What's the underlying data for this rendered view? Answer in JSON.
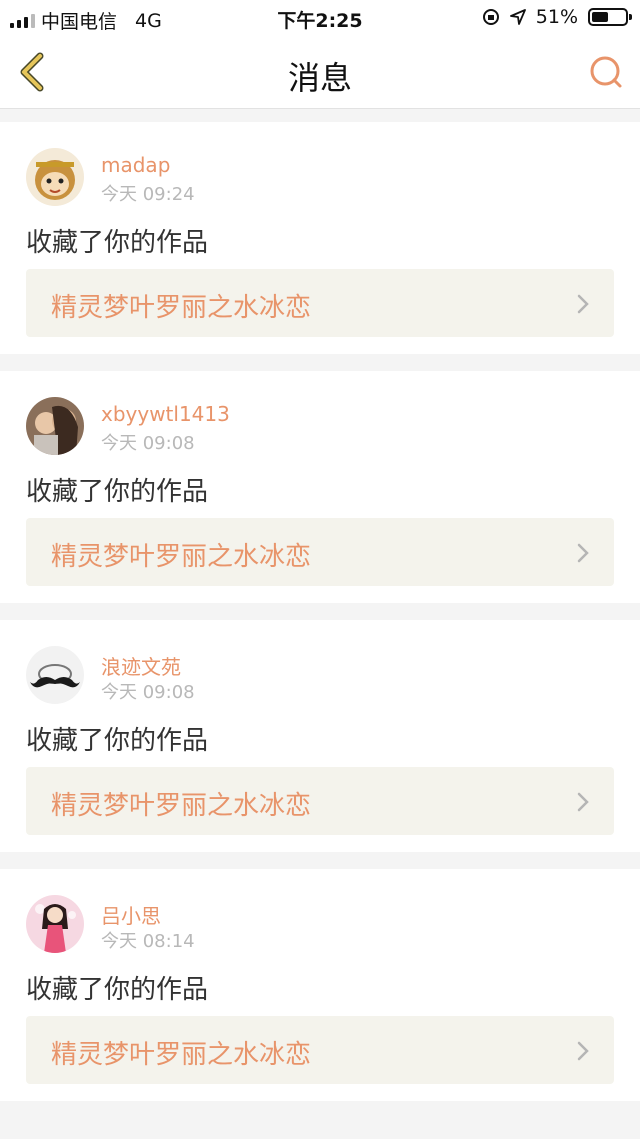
{
  "status_bar": {
    "carrier": "中国电信",
    "network": "4G",
    "time": "下午2:25",
    "battery": "51%",
    "battery_level": 0.51
  },
  "header": {
    "title": "消息"
  },
  "messages": [
    {
      "username": "madap",
      "time": "今天 09:24",
      "action": "收藏了你的作品",
      "work_title": "精灵梦叶罗丽之水冰恋"
    },
    {
      "username": "xbyywtl1413",
      "time": "今天 09:08",
      "action": "收藏了你的作品",
      "work_title": "精灵梦叶罗丽之水冰恋"
    },
    {
      "username": "浪迹文苑",
      "time": "今天 09:08",
      "action": "收藏了你的作品",
      "work_title": "精灵梦叶罗丽之水冰恋"
    },
    {
      "username": "吕小思",
      "time": "今天 08:14",
      "action": "收藏了你的作品",
      "work_title": "精灵梦叶罗丽之水冰恋"
    }
  ],
  "colors": {
    "accent": "#e8946a",
    "back_arrow": "#e6c65a",
    "card_bg": "#f4f3ec"
  },
  "icons": {
    "back": "chevron-left-icon",
    "search": "search-icon",
    "row_arrow": "chevron-right-icon"
  }
}
